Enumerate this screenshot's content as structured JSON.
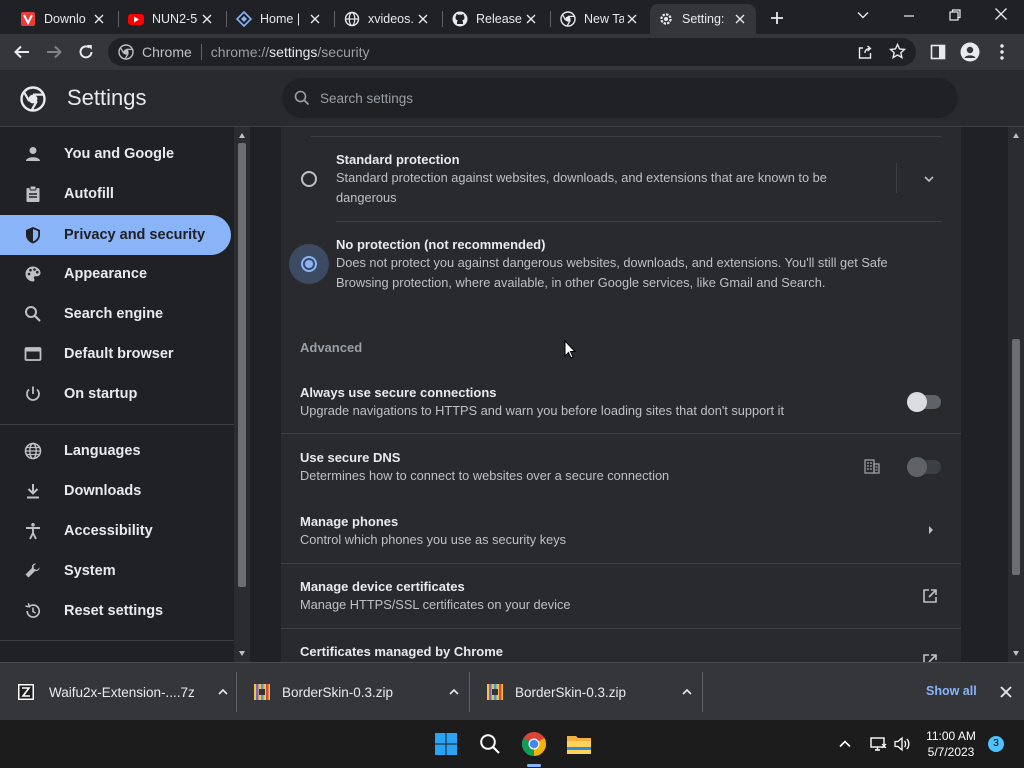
{
  "tabs": [
    {
      "title": "Downlo",
      "favicon": "vivaldi-v-icon"
    },
    {
      "title": "NUN2-5",
      "favicon": "youtube-icon"
    },
    {
      "title": "Home |",
      "favicon": "diamond-icon"
    },
    {
      "title": "xvideos.",
      "favicon": "globe-icon"
    },
    {
      "title": "Release",
      "favicon": "github-icon"
    },
    {
      "title": "New Tal",
      "favicon": "chrome-icon"
    },
    {
      "title": "Setting:",
      "favicon": "gear-icon"
    }
  ],
  "omnibox": {
    "chip": "Chrome",
    "url_prefix": "chrome://",
    "url_main": "settings",
    "url_suffix": "/security"
  },
  "settings": {
    "title": "Settings",
    "search_placeholder": "Search settings"
  },
  "sidebar": {
    "items": [
      {
        "label": "You and Google",
        "icon": "person-icon"
      },
      {
        "label": "Autofill",
        "icon": "clipboard-icon"
      },
      {
        "label": "Privacy and security",
        "icon": "shield-icon",
        "selected": true
      },
      {
        "label": "Appearance",
        "icon": "palette-icon"
      },
      {
        "label": "Search engine",
        "icon": "search-icon"
      },
      {
        "label": "Default browser",
        "icon": "browser-window-icon"
      },
      {
        "label": "On startup",
        "icon": "power-icon"
      },
      {
        "label": "Languages",
        "icon": "globe-icon"
      },
      {
        "label": "Downloads",
        "icon": "download-icon"
      },
      {
        "label": "Accessibility",
        "icon": "accessibility-icon"
      },
      {
        "label": "System",
        "icon": "wrench-icon"
      },
      {
        "label": "Reset settings",
        "icon": "history-icon"
      }
    ]
  },
  "security": {
    "standard": {
      "title": "Standard protection",
      "desc_line1": "Standard protection against websites, downloads, and extensions that are known to be",
      "desc_line2": "dangerous"
    },
    "none": {
      "title": "No protection (not recommended)",
      "desc_line1": "Does not protect you against dangerous websites, downloads, and extensions. You'll still get Safe",
      "desc_line2": "Browsing protection, where available, in other Google services, like Gmail and Search."
    },
    "advanced_heading": "Advanced",
    "rows": [
      {
        "title": "Always use secure connections",
        "desc": "Upgrade navigations to HTTPS and warn you before loading sites that don't support it"
      },
      {
        "title": "Use secure DNS",
        "desc": "Determines how to connect to websites over a secure connection"
      },
      {
        "title": "Manage phones",
        "desc": "Control which phones you use as security keys"
      },
      {
        "title": "Manage device certificates",
        "desc": "Manage HTTPS/SSL certificates on your device"
      },
      {
        "title": "Certificates managed by Chrome",
        "desc": ""
      }
    ]
  },
  "downloads": {
    "items": [
      {
        "name": "Waifu2x-Extension-....7z"
      },
      {
        "name": "BorderSkin-0.3.zip"
      },
      {
        "name": "BorderSkin-0.3.zip"
      }
    ],
    "show_all": "Show all"
  },
  "taskbar": {
    "time": "11:00 AM",
    "date": "5/7/2023",
    "notifications": "3"
  },
  "colors": {
    "accent": "#8ab4f8",
    "background": "#202124",
    "card": "#292a2d"
  }
}
